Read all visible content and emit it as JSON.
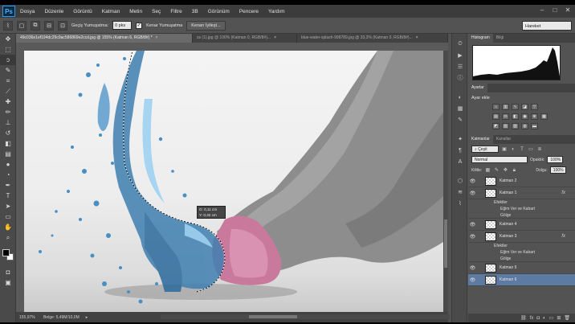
{
  "app": {
    "logo": "Ps"
  },
  "menu": [
    "Dosya",
    "Düzenle",
    "Görüntü",
    "Katman",
    "Metin",
    "Seç",
    "Filtre",
    "3B",
    "Görünüm",
    "Pencere",
    "Yardım"
  ],
  "window_controls": [
    "–",
    "□",
    "✕"
  ],
  "options": {
    "feather_label": "Geçiş Yumuşatma:",
    "feather_value": "0 pks",
    "antialias_check": "✓",
    "antialias_label": "Kenar Yumuşatma",
    "refine_button": "Kenarı İyileşt...",
    "workspace": "Hareket"
  },
  "doc_tabs": [
    {
      "label": "49c036e1ef194dc29c9ac586869e2ccd.jpg @ 155% (Katman 6, RGB/8#) *",
      "close": "×"
    },
    {
      "label": "ss (1).jpg @ 100% (Katman 0, RGB/8#)...",
      "close": "×"
    },
    {
      "label": "blue-water-splash-998789.jpg @ 33,3% (Katman 0, RGB/8#)...",
      "close": "×"
    }
  ],
  "measure": {
    "w_label": "G:",
    "w_value": "0,11 cm",
    "h_label": "Y:",
    "h_value": "0,32 cm"
  },
  "status": {
    "zoom": "155,97%",
    "doc": "Belge: 5,49M/10,0M",
    "arrow": "▸"
  },
  "panels": {
    "top_tabs": [
      "Histogram",
      "Bilgi"
    ],
    "adjust_tabs": [
      "Ayarlar"
    ],
    "adjust_title": "Ayar ekle",
    "layers_tabs": [
      "Katmanlar",
      "Kanallar"
    ],
    "kind_filter": "⌕ Çeşit",
    "blend_mode": "Normal",
    "opacity_label": "Opaklık:",
    "opacity_value": "100%",
    "lock_label": "Kilitle:",
    "fill_label": "Dolgu:",
    "fill_value": "100%"
  },
  "layers": [
    {
      "name": "Katman 2",
      "fx": "",
      "selected": false
    },
    {
      "name": "Katman 1",
      "fx": "fx",
      "selected": false,
      "effects": [
        "Efektler",
        "Eğim Ver ve Kabart",
        "Gölge"
      ]
    },
    {
      "name": "Katman 4",
      "fx": "",
      "selected": false
    },
    {
      "name": "Katman 3",
      "fx": "fx",
      "selected": false,
      "effects": [
        "Efektler",
        "Eğim Ver ve Kabart",
        "Gölge"
      ]
    },
    {
      "name": "Katman 5",
      "fx": "",
      "selected": false
    },
    {
      "name": "Katman 6",
      "fx": "",
      "selected": true
    }
  ],
  "colors": {
    "accent": "#2d9ae8",
    "selected_layer": "#5d7aa3",
    "panel_bg": "#535353"
  }
}
